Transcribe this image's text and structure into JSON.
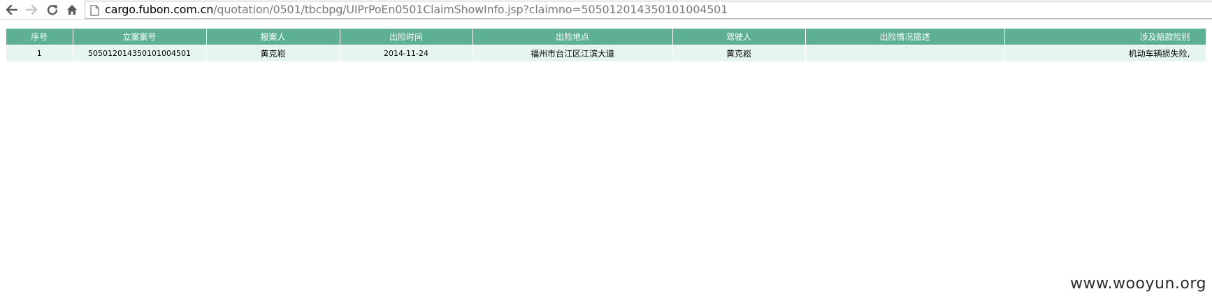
{
  "browser": {
    "back_icon": "arrow-left-icon",
    "forward_icon": "arrow-right-icon",
    "reload_icon": "reload-icon",
    "home_icon": "home-icon",
    "page_icon": "page-icon",
    "url_host": "cargo.fubon.com.cn",
    "url_path": "/quotation/0501/tbcbpg/UIPrPoEn0501ClaimShowInfo.jsp?claimno=505012014350101004501"
  },
  "table": {
    "header_color": "#5db093",
    "row_color": "#e6f5ef",
    "headers": {
      "seq": "序号",
      "claim_no": "立案案号",
      "reporter": "报案人",
      "accident_time": "出险时间",
      "accident_location": "出险地点",
      "driver": "驾驶人",
      "description": "出险情况描述",
      "coverage": "涉及赔款险别"
    },
    "rows": [
      {
        "seq": "1",
        "claim_no": "505012014350101004501",
        "reporter": "黄克崧",
        "accident_time": "2014-11-24",
        "accident_location": "福州市台江区江滨大道",
        "driver": "黄克崧",
        "description": "",
        "coverage": "机动车辆损失险,"
      }
    ]
  },
  "watermark": "www.wooyun.org"
}
